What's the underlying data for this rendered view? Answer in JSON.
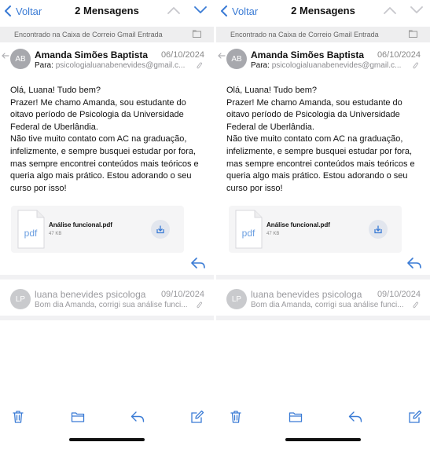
{
  "nav": {
    "back_label": "Voltar",
    "title": "2 Mensagens"
  },
  "folder_bar": {
    "text": "Encontrado na Caixa de Correio Gmail Entrada"
  },
  "message1": {
    "avatar_initials": "AB",
    "sender": "Amanda Simões Baptista",
    "date": "06/10/2024",
    "to_label": "Para:",
    "to_address": "psicologialuanabenevides@gmail.c...",
    "body_lines": [
      "Olá, Luana! Tudo bem?",
      "Prazer! Me chamo Amanda, sou estudante do",
      "oitavo período de Psicologia da Universidade",
      "Federal de Uberlândia.",
      "Não tive muito contato com AC na graduação,",
      "infelizmente, e sempre busquei estudar por fora,",
      "mas sempre encontrei conteúdos mais teóricos e",
      "queria algo mais prático. Estou adorando o seu",
      "curso por isso!"
    ],
    "attachment": {
      "icon_label": "pdf",
      "name": "Análise funcional.pdf",
      "size": "47 KB"
    }
  },
  "message2": {
    "avatar_initials": "LP",
    "sender": "luana benevides psicologa",
    "date": "09/10/2024",
    "preview": "Bom dia Amanda, corrigi sua análise funci..."
  },
  "icons": {
    "back": "chevron-left-icon",
    "prev": "chevron-up-icon",
    "next": "chevron-down-icon",
    "folder": "folder-icon",
    "download": "download-icon",
    "reply": "reply-icon",
    "trash": "trash-icon",
    "compose": "compose-icon",
    "attachment": "paperclip-icon"
  },
  "colors": {
    "accent": "#3a7bd5",
    "muted": "#9a9a9e",
    "folder_bar_bg": "#eeeeef"
  }
}
